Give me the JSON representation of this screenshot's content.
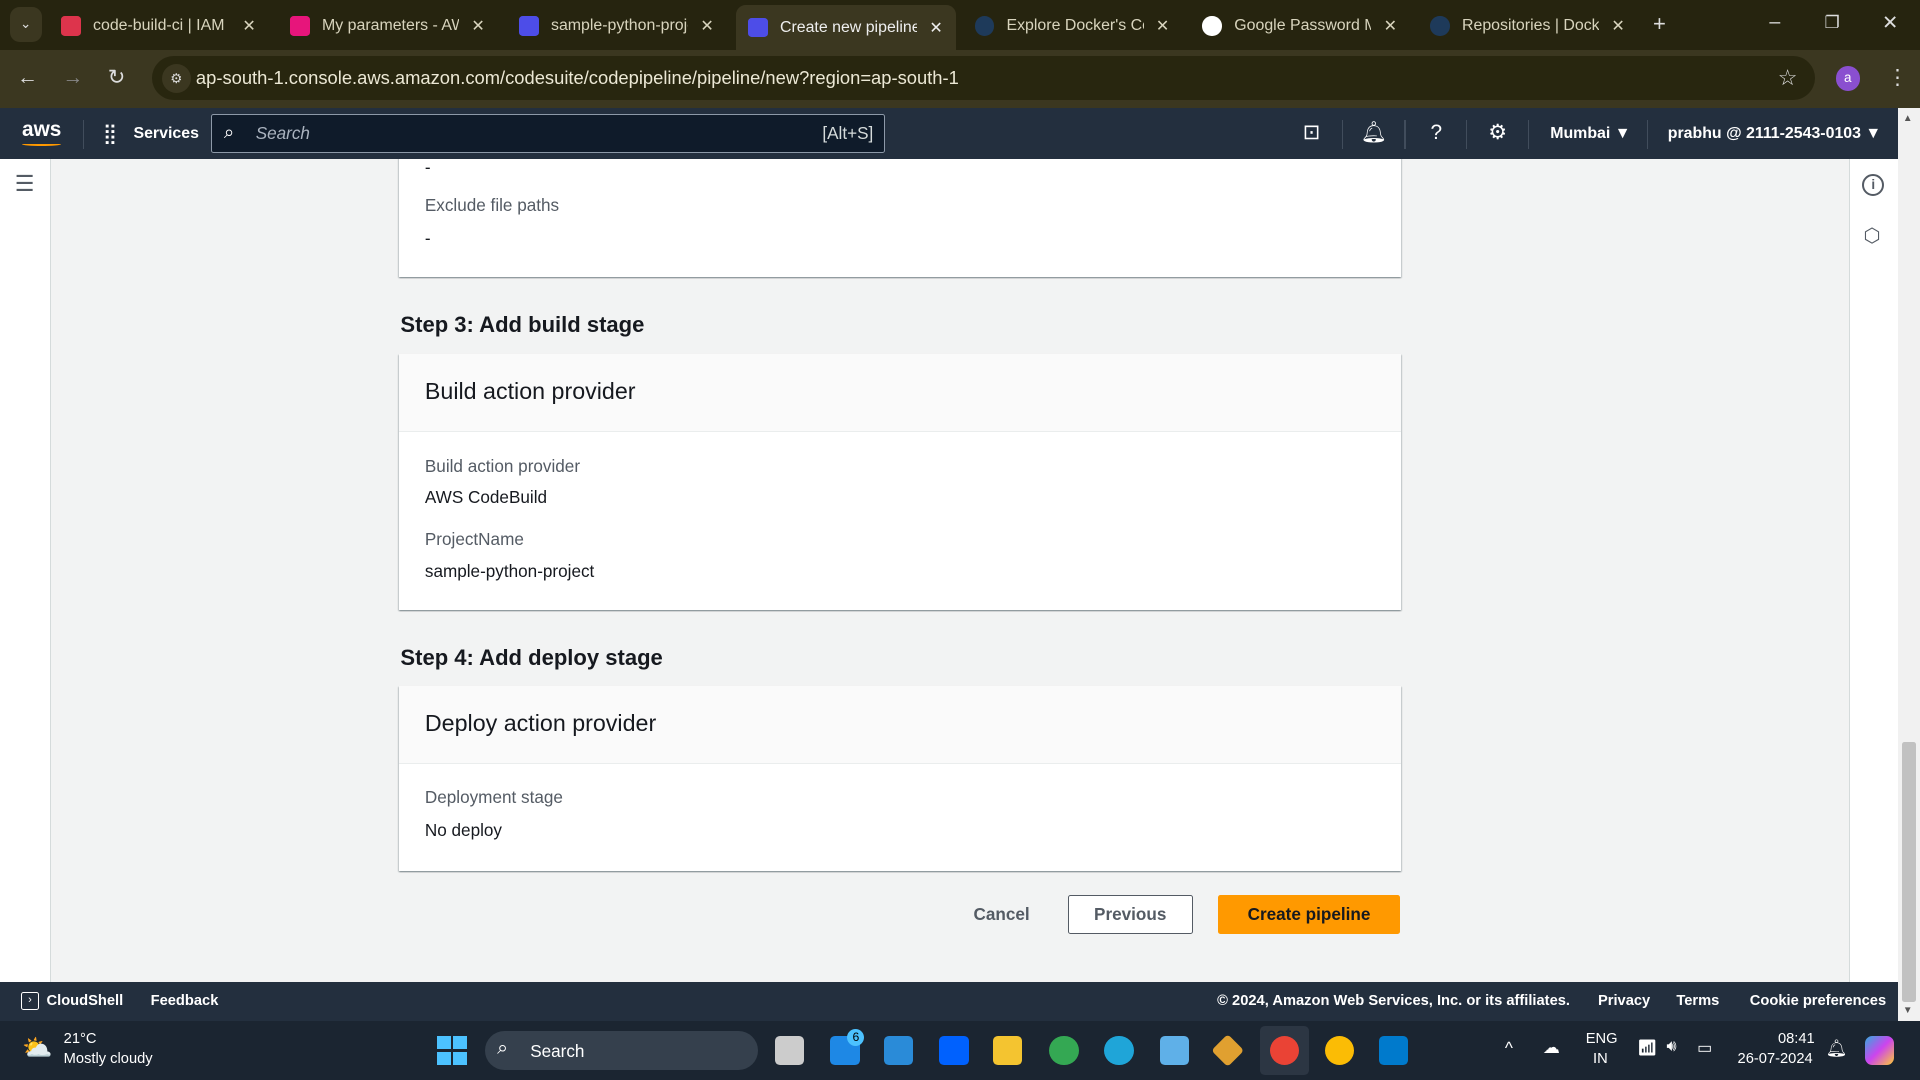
{
  "browser": {
    "tabs": [
      {
        "title": "code-build-ci | IAM |",
        "color": "#dd344c"
      },
      {
        "title": "My parameters - AWS",
        "color": "#e7157b"
      },
      {
        "title": "sample-python-proje",
        "color": "#4d4de8"
      },
      {
        "title": "Create new pipeline |",
        "color": "#4d4de8",
        "active": true
      },
      {
        "title": "Explore Docker's Con",
        "color": "#1d63ed"
      },
      {
        "title": "Google Password Ma",
        "color": "#ffffff"
      },
      {
        "title": "Repositories | Docker",
        "color": "#1d63ed"
      }
    ],
    "url": "ap-south-1.console.aws.amazon.com/codesuite/codepipeline/pipeline/new?region=ap-south-1",
    "profile_initial": "a"
  },
  "aws_nav": {
    "logo": "aws",
    "services": "Services",
    "search_placeholder": "Search",
    "search_shortcut": "[Alt+S]",
    "region": "Mumbai",
    "account": "prabhu @ 2111-2543-0103"
  },
  "source_card": {
    "prev_value": "-",
    "exclude_label": "Exclude file paths",
    "exclude_value": "-"
  },
  "step3": {
    "heading": "Step 3: Add build stage",
    "card_title": "Build action provider",
    "fields": [
      {
        "label": "Build action provider",
        "value": "AWS CodeBuild"
      },
      {
        "label": "ProjectName",
        "value": "sample-python-project"
      }
    ]
  },
  "step4": {
    "heading": "Step 4: Add deploy stage",
    "card_title": "Deploy action provider",
    "fields": [
      {
        "label": "Deployment stage",
        "value": "No deploy"
      }
    ]
  },
  "actions": {
    "cancel": "Cancel",
    "previous": "Previous",
    "create": "Create pipeline",
    "accent": "#ff9900"
  },
  "footer": {
    "cloudshell": "CloudShell",
    "feedback": "Feedback",
    "copyright": "© 2024, Amazon Web Services, Inc. or its affiliates.",
    "privacy": "Privacy",
    "terms": "Terms",
    "cookies": "Cookie preferences"
  },
  "taskbar": {
    "temp": "21°C",
    "weather": "Mostly cloudy",
    "search": "Search",
    "badge": "6",
    "lang1": "ENG",
    "lang2": "IN",
    "time": "08:41",
    "date": "26-07-2024"
  }
}
